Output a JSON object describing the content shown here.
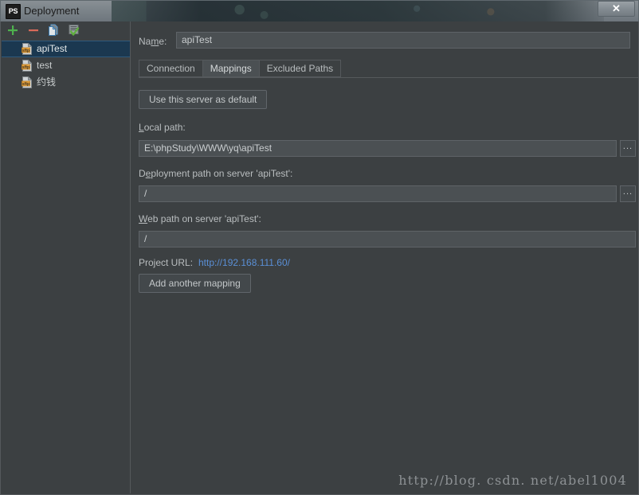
{
  "window": {
    "title": "Deployment",
    "app_icon": "PS",
    "close_label": "✕"
  },
  "toolbar": {
    "items": [
      {
        "name": "add-server-button",
        "icon": "plus-icon",
        "tooltip": "Add"
      },
      {
        "name": "remove-server-button",
        "icon": "minus-icon",
        "tooltip": "Remove"
      },
      {
        "name": "copy-server-button",
        "icon": "copy-icon",
        "tooltip": "Copy"
      },
      {
        "name": "set-default-button",
        "icon": "check-list-icon",
        "tooltip": "Use as default"
      }
    ]
  },
  "sidebar": {
    "items": [
      {
        "label": "apiTest",
        "icon": "sftp-file-icon",
        "selected": true
      },
      {
        "label": "test",
        "icon": "sftp-file-icon",
        "selected": false
      },
      {
        "label": "约钱",
        "icon": "sftp-file-icon",
        "selected": false
      }
    ]
  },
  "form": {
    "name_label": "Na",
    "name_label_mnemonic": "m",
    "name_label_rest": "e:",
    "name_value": "apiTest",
    "use_default_button": "Use this server as default",
    "local_path_label_pre": "",
    "local_path_label_mnemonic": "L",
    "local_path_label_rest": "ocal path:",
    "local_path_value": "E:\\phpStudy\\WWW\\yq\\apiTest",
    "deployment_path_label_pre": "D",
    "deployment_path_label_mnemonic": "e",
    "deployment_path_label_rest": "ployment path on server 'apiTest':",
    "deployment_path_value": "/",
    "web_path_label_pre": "",
    "web_path_label_mnemonic": "W",
    "web_path_label_rest": "eb path on server 'apiTest':",
    "web_path_value": "/",
    "project_url_label": "Project URL:",
    "project_url_value": "http://192.168.111.60/",
    "add_mapping_button": "Add another mapping",
    "browse_label": "..."
  },
  "tabs": [
    {
      "label": "Connection",
      "active": false
    },
    {
      "label": "Mappings",
      "active": true
    },
    {
      "label": "Excluded Paths",
      "active": false
    }
  ],
  "watermark": "http://blog. csdn. net/abel1004",
  "colors": {
    "dialog_bg": "#3c4042",
    "field_bg": "#4b5053",
    "selection": "#1b3850",
    "link": "#5a8fd6",
    "add_icon": "#4eb14e",
    "remove_icon": "#d96a5a",
    "copy_icon": "#5b9bd0",
    "check_icon": "#5fae3f",
    "sftp_icon": "#e8a33d"
  }
}
